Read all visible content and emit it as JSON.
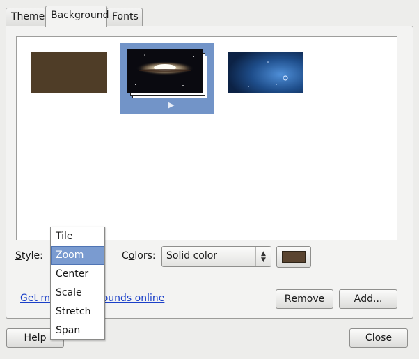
{
  "tabs": [
    {
      "label": "Theme",
      "active": false
    },
    {
      "label": "Background",
      "active": true
    },
    {
      "label": "Fonts",
      "active": false
    }
  ],
  "gallery": {
    "items": [
      {
        "name": "Solid brown background",
        "selected": false,
        "color": "#4f3d27"
      },
      {
        "name": "Sombrero galaxy slideshow",
        "selected": true,
        "play_glyph": "▶"
      },
      {
        "name": "Blue space wallpaper",
        "selected": false,
        "color": "#1e4d8a"
      }
    ]
  },
  "style": {
    "label_prefix": "",
    "label_underlined": "S",
    "label_rest": "tyle:",
    "options": [
      "Tile",
      "Zoom",
      "Center",
      "Scale",
      "Stretch",
      "Span"
    ],
    "selected": "Zoom"
  },
  "colors": {
    "label_prefix": "C",
    "label_underlined": "o",
    "label_rest": "lors:",
    "combo_value": "Solid color",
    "swatch_color": "#5a4430"
  },
  "link": {
    "text": "Get more backgrounds online"
  },
  "buttons": {
    "remove": {
      "underlined": "R",
      "rest": "emove"
    },
    "add": {
      "underlined": "A",
      "rest": "dd..."
    },
    "help": {
      "underlined": "H",
      "rest": "elp"
    },
    "close": {
      "underlined": "C",
      "rest": "lose"
    }
  },
  "colors_palette": {
    "accent": "#7294c8",
    "link": "#1a3fc8",
    "dialog_bg": "#ededeb"
  }
}
